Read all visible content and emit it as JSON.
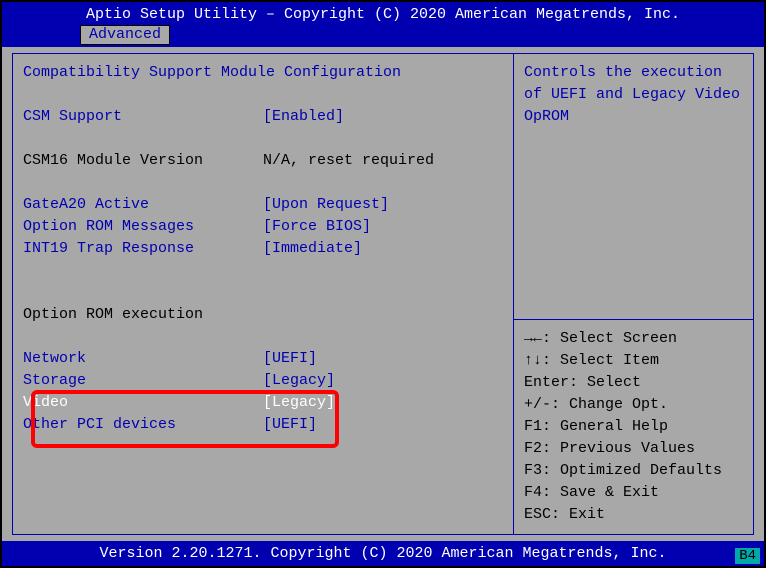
{
  "header": {
    "title": "Aptio Setup Utility – Copyright (C) 2020 American Megatrends, Inc.",
    "tab": "Advanced"
  },
  "left": {
    "section_title": "Compatibility Support Module Configuration",
    "csm_support": {
      "label": "CSM Support",
      "value": "[Enabled]"
    },
    "csm16_version": {
      "label": "CSM16 Module Version",
      "value": "N/A, reset required"
    },
    "gatea20": {
      "label": "GateA20 Active",
      "value": "[Upon Request]"
    },
    "oprom_msgs": {
      "label": "Option ROM Messages",
      "value": "[Force BIOS]"
    },
    "int19": {
      "label": "INT19 Trap Response",
      "value": "[Immediate]"
    },
    "oprom_exec_title": "Option ROM execution",
    "network": {
      "label": "Network",
      "value": "[UEFI]"
    },
    "storage": {
      "label": "Storage",
      "value": "[Legacy]"
    },
    "video": {
      "label": "Video",
      "value": "[Legacy]"
    },
    "other_pci": {
      "label": "Other PCI devices",
      "value": "[UEFI]"
    }
  },
  "right": {
    "help_text": "Controls the execution of UEFI and Legacy Video OpROM",
    "keys": [
      {
        "k": "→←: ",
        "d": "Select Screen"
      },
      {
        "k": "↑↓: ",
        "d": "Select Item"
      },
      {
        "k": "Enter: ",
        "d": "Select"
      },
      {
        "k": "+/-: ",
        "d": "Change Opt."
      },
      {
        "k": "F1: ",
        "d": "General Help"
      },
      {
        "k": "F2: ",
        "d": "Previous Values"
      },
      {
        "k": "F3: ",
        "d": "Optimized Defaults"
      },
      {
        "k": "F4: ",
        "d": "Save & Exit"
      },
      {
        "k": "ESC: ",
        "d": "Exit"
      }
    ]
  },
  "footer": {
    "version": "Version 2.20.1271. Copyright (C) 2020 American Megatrends, Inc.",
    "badge": "B4"
  }
}
